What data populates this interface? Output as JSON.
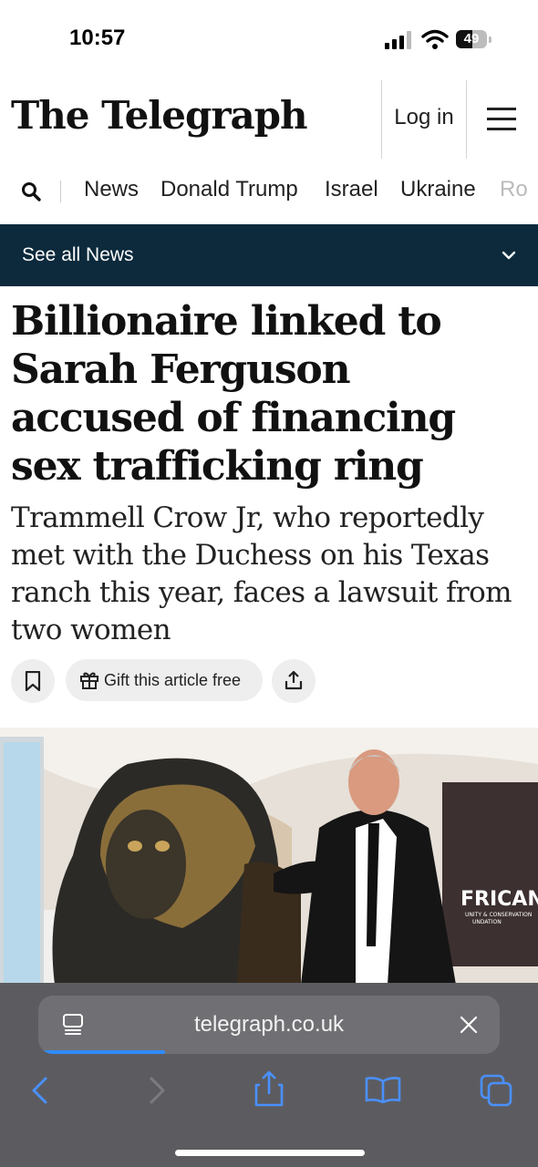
{
  "status_bar": {
    "time": "10:57",
    "battery": "49"
  },
  "masthead": {
    "logo": "The Telegraph",
    "login_label": "Log in"
  },
  "nav": {
    "items": [
      "News",
      "Donald Trump",
      "Israel",
      "Ukraine",
      "Ro"
    ]
  },
  "section_bar": {
    "label": "See all News"
  },
  "article": {
    "headline": "Billionaire linked to Sarah Ferguson accused of financing sex trafficking ring",
    "standfirst": "Trammell Crow Jr, who reportedly met with the Duchess on his Texas ranch this year, faces a lawsuit from two women",
    "gift_label": "Gift this article free"
  },
  "photo": {
    "banner_text": "FRICAN",
    "banner_subtext": "UNITY & CONSERVATION",
    "banner_subtext2": "UNDATION"
  },
  "browser": {
    "url": "telegraph.co.uk",
    "load_progress": 0.27
  },
  "colors": {
    "section_bar": "#0c2a3c",
    "accent": "#2f8bff",
    "toolbar": "#5c5c60"
  }
}
